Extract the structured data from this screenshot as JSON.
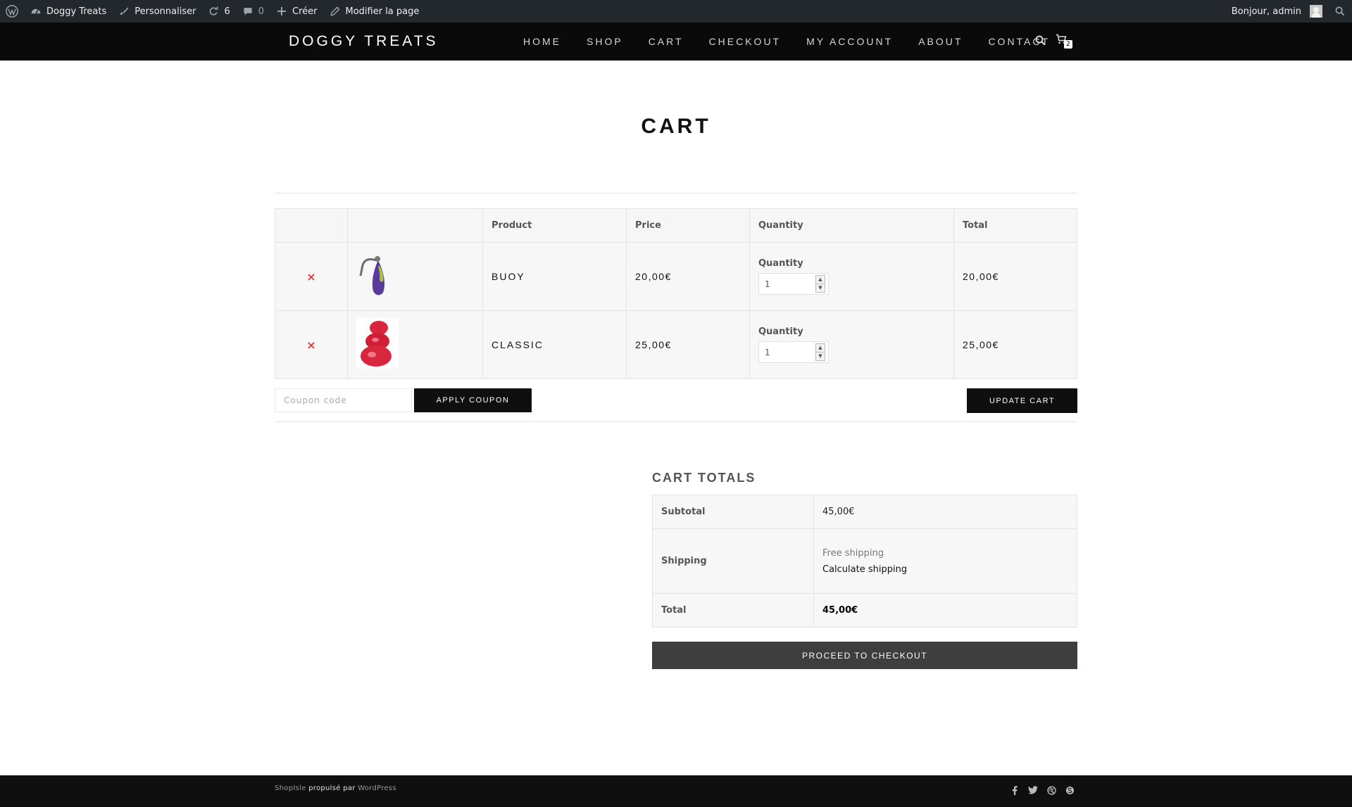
{
  "admin_bar": {
    "site_name": "Doggy Treats",
    "customize": "Personnaliser",
    "updates_count": "6",
    "comments_count": "0",
    "new": "Créer",
    "edit_page": "Modifier la page",
    "greeting": "Bonjour, admin"
  },
  "site": {
    "brand": "DOGGY TREATS",
    "nav": [
      "HOME",
      "SHOP",
      "CART",
      "CHECKOUT",
      "MY ACCOUNT",
      "ABOUT",
      "CONTACT"
    ],
    "cart_count": "2"
  },
  "page": {
    "title": "CART"
  },
  "cart": {
    "headers": {
      "product": "Product",
      "price": "Price",
      "quantity": "Quantity",
      "total": "Total"
    },
    "remove_symbol": "×",
    "qty_label": "Quantity",
    "items": [
      {
        "name": "BUOY",
        "price": "20,00€",
        "quantity": "1",
        "total": "20,00€",
        "thumb_color": "#5b3a9c"
      },
      {
        "name": "CLASSIC",
        "price": "25,00€",
        "quantity": "1",
        "total": "25,00€",
        "thumb_color": "#d7263d"
      }
    ],
    "coupon_placeholder": "Coupon code",
    "apply_coupon": "APPLY COUPON",
    "update_cart": "UPDATE CART"
  },
  "totals": {
    "title": "CART TOTALS",
    "subtotal_label": "Subtotal",
    "subtotal_value": "45,00€",
    "shipping_label": "Shipping",
    "shipping_method": "Free shipping",
    "calculate_shipping": "Calculate shipping",
    "total_label": "Total",
    "total_value": "45,00€",
    "checkout_button": "PROCEED TO CHECKOUT"
  },
  "footer": {
    "theme": "ShopIsle",
    "powered": "propulsé par",
    "platform": "WordPress",
    "social_icons": [
      "facebook-icon",
      "twitter-icon",
      "dribbble-icon",
      "skype-icon"
    ]
  },
  "colors": {
    "admin_bar": "#23282d",
    "header": "#0a0a0a",
    "remove": "#e33b3b",
    "button": "#0f0f0f",
    "checkout": "#3e3e3e"
  }
}
